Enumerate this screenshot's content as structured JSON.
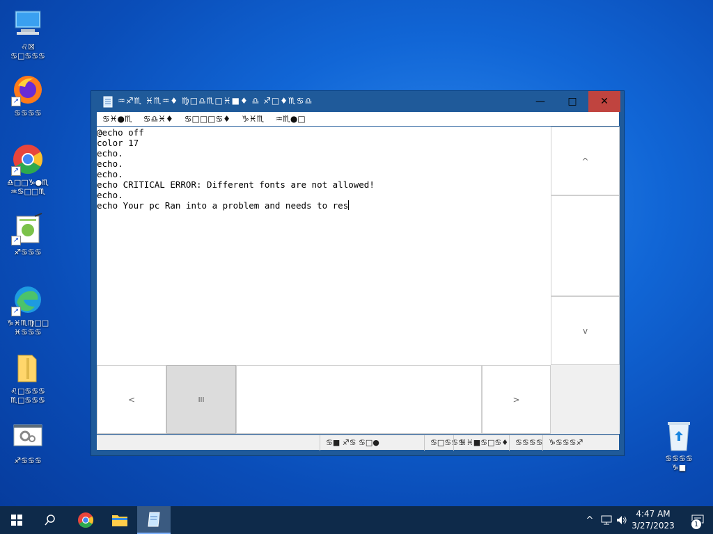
{
  "desktop": {
    "icons": [
      {
        "label": "♌☒\n♋□♋♋♋"
      },
      {
        "label": "♋♋♋♋"
      },
      {
        "label": "♎□□♑●♏\n♒♋□□♏"
      },
      {
        "label": "♐♋♋♋"
      },
      {
        "label": "♑♓♏♍□□\n♓♋♋♋"
      },
      {
        "label": "♌□♋♋♋\n♏□♋♋♋"
      },
      {
        "label": "♐♋♋♋"
      }
    ],
    "recycle_bin": {
      "label": "♋♋♋♋\n♑■"
    }
  },
  "window": {
    "title": "♒♐♏ ♓♏♒♦ ♍□♎♏□♓■♦ ♎ ♐□♦♏♋♎",
    "controls": {
      "minimize": "—",
      "maximize": "□",
      "close": "✕"
    },
    "menu": [
      "♋♓●♏",
      "♋♎♓♦",
      "♋□□□♋♦",
      "♑♓♏",
      "♒♏●□"
    ],
    "editor_lines": [
      "@echo off",
      "color 17",
      "echo.",
      "echo.",
      "echo.",
      "echo CRITICAL ERROR: Different fonts are not allowed!",
      "echo.",
      "echo Your pc Ran into a problem and needs to res"
    ],
    "scroll": {
      "up": "^",
      "down": "v",
      "left": "<",
      "right": ">",
      "thumb": "III"
    },
    "status": [
      "♋■ ♐♋ ♋□●",
      "♋□♋♋♋",
      "♓♓■♋□♋♦",
      "♋♋♋♋",
      "♑♋♋♋♐"
    ]
  },
  "taskbar": {
    "start": "⊞",
    "search": "⌕",
    "tray_chevron": "^",
    "time": "4:47 AM",
    "date": "3/27/2023",
    "notification_count": "1"
  },
  "colors": {
    "title_bar": "#1f5a9a",
    "close_button": "#c0443f",
    "taskbar": "#0e2a4a"
  }
}
